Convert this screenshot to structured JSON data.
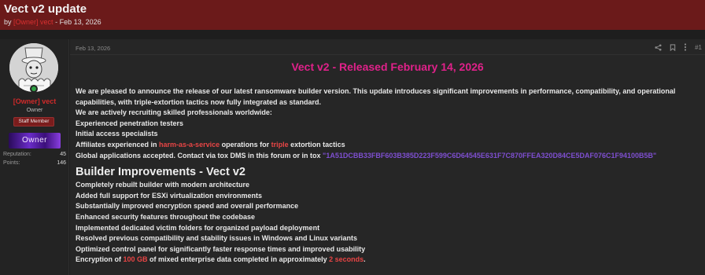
{
  "thread": {
    "title": "Vect v2 update",
    "by": "by",
    "author": "[Owner] vect",
    "separator": "-",
    "date": "Feb 13, 2026"
  },
  "user": {
    "name": "[Owner] vect",
    "title": "Owner",
    "badge": "Staff Member",
    "banner": "Owner",
    "stats": [
      {
        "label": "Reputation:",
        "value": "45"
      },
      {
        "label": "Points:",
        "value": "146"
      }
    ]
  },
  "post": {
    "date": "Feb 13, 2026",
    "number": "#1",
    "release_title": "Vect v2 - Released February 14, 2026",
    "intro": "We are pleased to announce the release of our latest ransomware builder version. This update introduces significant improvements in performance, compatibility, and operational capabilities, with triple-extortion tactics now fully integrated as standard.",
    "recruit": "We are actively recruiting skilled professionals worldwide:",
    "roles": [
      "Experienced penetration testers",
      "Initial access specialists"
    ],
    "affiliates_a": "Affiliates experienced in ",
    "affiliates_hl1": "harm-as-a-service",
    "affiliates_b": " operations for ",
    "affiliates_hl2": "triple",
    "affiliates_c": " extortion tactics",
    "global_a": "Global applications accepted. Contact via tox DMS in this forum or in tox ",
    "tox_id": "\"1A51DCBB33FBF603B385D223F599C6D64545E631F7C870FFEA320D84CE5DAF076C1F94100B5B\"",
    "section_heading": "Builder Improvements - Vect v2",
    "improvements": [
      "Completely rebuilt builder with modern architecture",
      "Added full support for ESXi virtualization environments",
      "Substantially improved encryption speed and overall performance",
      "Enhanced security features throughout the codebase",
      "Implemented dedicated victim folders for organized payload deployment",
      "Resolved previous compatibility and stability issues in Windows and Linux variants",
      "Optimized control panel for significantly faster response times and improved usability"
    ],
    "encryption_a": "Encryption of ",
    "encryption_hl1": "100 GB",
    "encryption_b": " of mixed enterprise data completed in approximately ",
    "encryption_hl2": "2 seconds",
    "encryption_c": "."
  },
  "icons": [
    "share-icon",
    "bookmark-icon",
    "more-icon"
  ],
  "colors": {
    "header_bg": "#6b1a1a",
    "accent_pink": "#e0218a",
    "highlight_red": "#e84545",
    "tox_purple": "#7e4fd0",
    "staff_badge": "#7a1c1c"
  }
}
